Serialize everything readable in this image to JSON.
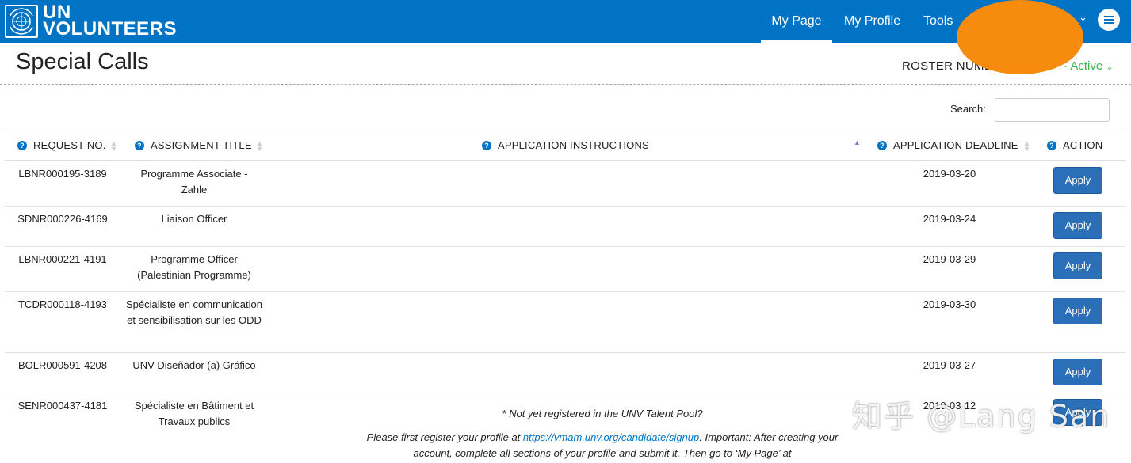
{
  "header": {
    "brand_line1": "UN",
    "brand_line2": "VOLUNTEERS",
    "nav": [
      "My Page",
      "My Profile",
      "Tools"
    ],
    "brand_color": "#0073c5"
  },
  "page": {
    "title": "Special Calls",
    "roster_label": "ROSTER NUMB",
    "roster_status": "- Active",
    "search_label": "Search:",
    "search_value": ""
  },
  "table": {
    "columns": [
      "REQUEST NO.",
      "ASSIGNMENT TITLE",
      "APPLICATION INSTRUCTIONS",
      "APPLICATION DEADLINE",
      "ACTION"
    ],
    "rows": [
      {
        "request": "LBNR000195-3189",
        "title": "Programme Associate - Zahle",
        "instructions": "",
        "deadline": "2019-03-20",
        "action": "Apply"
      },
      {
        "request": "SDNR000226-4169",
        "title": "Liaison Officer",
        "instructions": "",
        "deadline": "2019-03-24",
        "action": "Apply"
      },
      {
        "request": "LBNR000221-4191",
        "title": "Programme Officer (Palestinian Programme)",
        "instructions": "",
        "deadline": "2019-03-29",
        "action": "Apply"
      },
      {
        "request": "TCDR000118-4193",
        "title": "Spécialiste en communication et sensibilisation sur les ODD",
        "instructions": "",
        "deadline": "2019-03-30",
        "action": "Apply"
      },
      {
        "request": "BOLR000591-4208",
        "title": "UNV Diseñador (a) Gráfico",
        "instructions": "",
        "deadline": "2019-03-27",
        "action": "Apply"
      },
      {
        "request": "SENR000437-4181",
        "title": "Spécialiste en Bâtiment et Travaux publics",
        "instructions": "",
        "deadline": "2019-03-12",
        "action": "Apply"
      }
    ]
  },
  "notice": {
    "line1": "* Not yet registered in the UNV Talent Pool?",
    "line2_prefix": "Please first register your profile at ",
    "link": "https://vmam.unv.org/candidate/signup",
    "line2_suffix": ". Important: After creating your",
    "line3": "account, complete all sections of your profile and submit it. Then go to ‘My Page’ at"
  },
  "watermark": "知乎 @Lang San"
}
